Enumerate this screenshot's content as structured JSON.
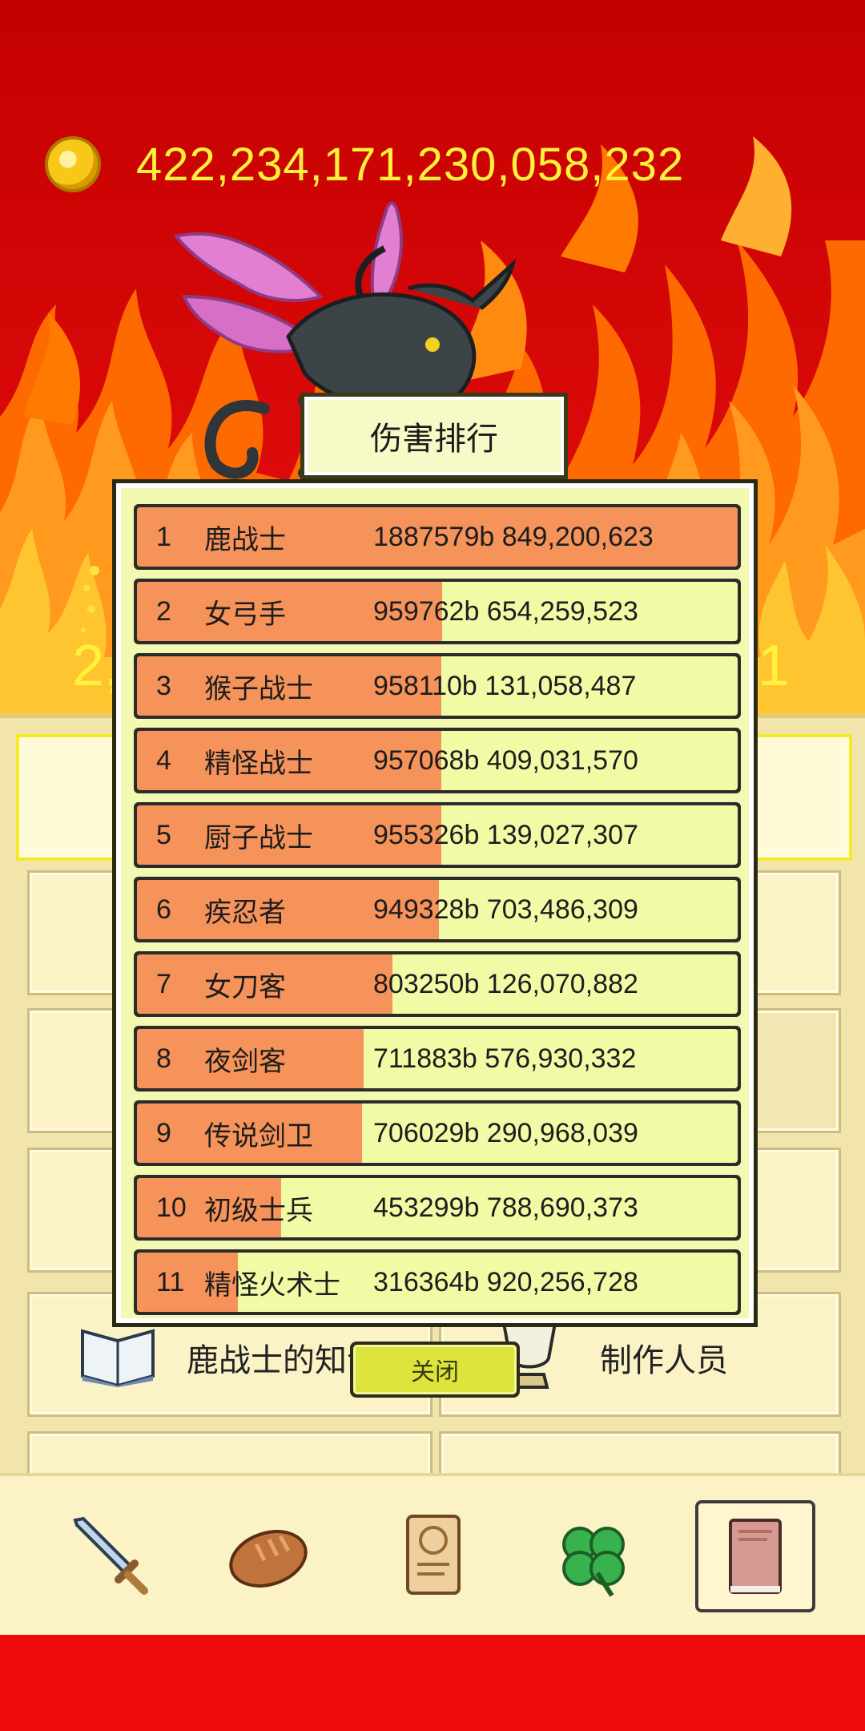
{
  "header": {
    "coin_amount": "422,234,171,230,058,232"
  },
  "side_numbers": {
    "left": "2,",
    "right": "1"
  },
  "popup": {
    "title": "伤害排行",
    "close_label": "关闭",
    "rows": [
      {
        "rank": "1",
        "name": "鹿战士",
        "damage": "1887579b 849,200,623",
        "bar_fraction": 1.0
      },
      {
        "rank": "2",
        "name": "女弓手",
        "damage": "959762b 654,259,523",
        "bar_fraction": 0.508
      },
      {
        "rank": "3",
        "name": "猴子战士",
        "damage": "958110b 131,058,487",
        "bar_fraction": 0.507
      },
      {
        "rank": "4",
        "name": "精怪战士",
        "damage": "957068b 409,031,570",
        "bar_fraction": 0.507
      },
      {
        "rank": "5",
        "name": "厨子战士",
        "damage": "955326b 139,027,307",
        "bar_fraction": 0.506
      },
      {
        "rank": "6",
        "name": "疾忍者",
        "damage": "949328b 703,486,309",
        "bar_fraction": 0.503
      },
      {
        "rank": "7",
        "name": "女刀客",
        "damage": "803250b 126,070,882",
        "bar_fraction": 0.426
      },
      {
        "rank": "8",
        "name": "夜剑客",
        "damage": "711883b 576,930,332",
        "bar_fraction": 0.377
      },
      {
        "rank": "9",
        "name": "传说剑卫",
        "damage": "706029b 290,968,039",
        "bar_fraction": 0.374
      },
      {
        "rank": "10",
        "name": "初级士兵",
        "damage": "453299b 788,690,373",
        "bar_fraction": 0.24
      },
      {
        "rank": "11",
        "name": "精怪火术士",
        "damage": "316364b 920,256,728",
        "bar_fraction": 0.168
      }
    ]
  },
  "menu": {
    "knowledge_label": "鹿战士的知识",
    "credits_label": "制作人员"
  },
  "bottom_nav": {
    "items": [
      {
        "icon": "sword-icon"
      },
      {
        "icon": "bread-icon"
      },
      {
        "icon": "scroll-icon"
      },
      {
        "icon": "clover-icon"
      },
      {
        "icon": "book-icon",
        "active": true
      }
    ]
  },
  "colors": {
    "coin_text": "#fff23a",
    "bar_fill": "#f5935a",
    "bar_bg": "#f1fba5",
    "close_button": "#dde53c"
  }
}
